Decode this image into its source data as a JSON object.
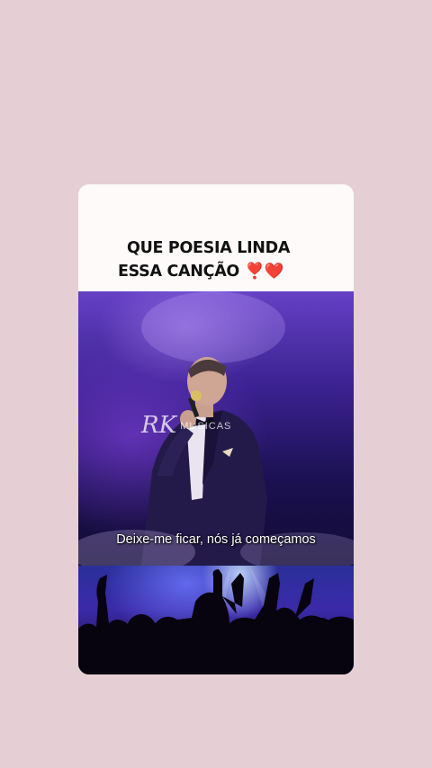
{
  "post": {
    "caption_line1": "QUE POESIA LINDA",
    "caption_line2": "ESSA CANÇÃO",
    "caption_emoji": "❣️❤️"
  },
  "video": {
    "watermark_text": "RK",
    "watermark_sub": "MUSICAS",
    "subtitle": "Deixe-me ficar, nós já começamos"
  },
  "colors": {
    "page_background": "#e6cfd4",
    "card_background": "#fdfaf9",
    "stage_purple": "#6540c4"
  }
}
